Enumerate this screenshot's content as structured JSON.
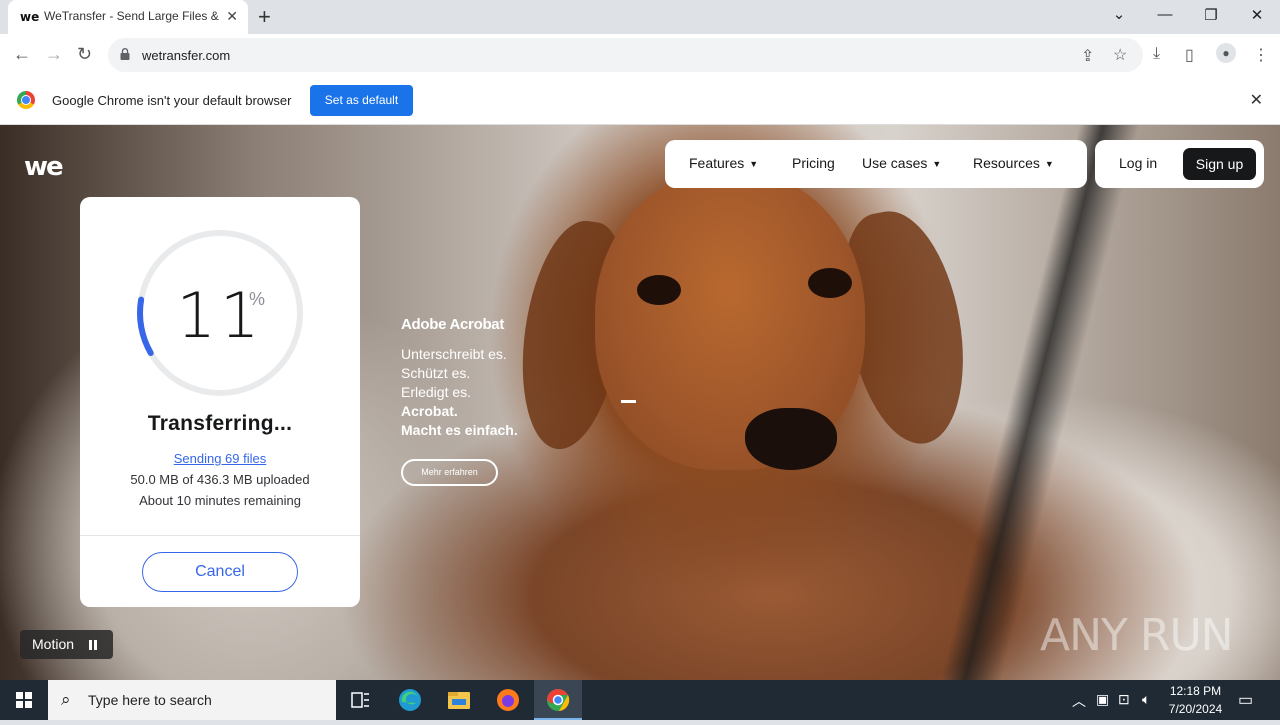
{
  "browser": {
    "tab_title": "WeTransfer - Send Large Files & Share Photos Online",
    "tab_favicon": "we",
    "new_tab": "+",
    "url": "wetransfer.com"
  },
  "infobar": {
    "message": "Google Chrome isn't your default browser",
    "button": "Set as default"
  },
  "site": {
    "logo": "we",
    "nav": [
      "Features",
      "Pricing",
      "Use cases",
      "Resources"
    ],
    "login": "Log in",
    "signup": "Sign up"
  },
  "transfer": {
    "percent": "11",
    "percent_sign": "%",
    "progress_fraction": 0.11,
    "status": "Transferring...",
    "sending": "Sending 69 files",
    "uploaded": "50.0 MB of 436.3 MB uploaded",
    "remaining": "About 10 minutes remaining",
    "cancel": "Cancel",
    "accent_color": "#3767e8"
  },
  "ad": {
    "brand": "Adobe Acrobat",
    "lines": [
      "Unterschreibt es.",
      "Schützt es.",
      "Erledigt es."
    ],
    "bold_lines": [
      "Acrobat.",
      "Macht es einfach."
    ],
    "button": "Mehr erfahren"
  },
  "motion": {
    "label": "Motion"
  },
  "watermark": "ANY RUN",
  "taskbar": {
    "search_placeholder": "Type here to search",
    "time": "12:18 PM",
    "date": "7/20/2024"
  }
}
